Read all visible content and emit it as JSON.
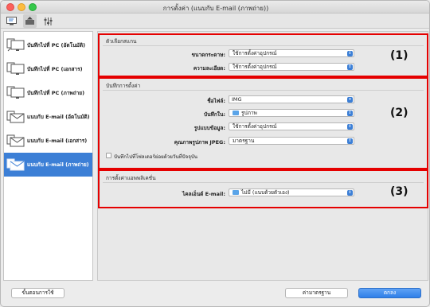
{
  "window": {
    "title": "การตั้งค่า (แนบกับ E-mail (ภาพถ่าย))"
  },
  "toolbar": {
    "tabs": [
      {
        "icon": "scan-from-computer-icon"
      },
      {
        "icon": "scan-from-operation-panel-icon"
      },
      {
        "icon": "general-settings-icon"
      }
    ]
  },
  "sidebar": {
    "items": [
      {
        "label": "บันทึกไปที่ PC (อัตโนมัติ)",
        "icon": "save-to-pc-icon"
      },
      {
        "label": "บันทึกไปที่ PC (เอกสาร)",
        "icon": "save-to-pc-icon"
      },
      {
        "label": "บันทึกไปที่ PC (ภาพถ่าย)",
        "icon": "save-to-pc-icon"
      },
      {
        "label": "แนบกับ E-mail (อัตโนมัติ)",
        "icon": "email-icon"
      },
      {
        "label": "แนบกับ E-mail (เอกสาร)",
        "icon": "email-icon"
      },
      {
        "label": "แนบกับ E-mail (ภาพถ่าย)",
        "icon": "email-icon"
      }
    ],
    "selected_index": 5
  },
  "scan_options": {
    "title": "ตัวเลือกสแกน",
    "paper_size_label": "ขนาดกระดาษ:",
    "paper_size_value": "ใช้การตั้งค่าอุปกรณ์",
    "resolution_label": "ความละเอียด:",
    "resolution_value": "ใช้การตั้งค่าอุปกรณ์"
  },
  "save_settings": {
    "title": "บันทึกการตั้งค่า",
    "file_name_label": "ชื่อไฟล์:",
    "file_name_value": "IMG",
    "save_in_label": "บันทึกใน:",
    "save_in_value": "รูปภาพ",
    "data_format_label": "รูปแบบข้อมูล:",
    "data_format_value": "ใช้การตั้งค่าอุปกรณ์",
    "jpeg_quality_label": "คุณภาพรูปภาพ JPEG:",
    "jpeg_quality_value": "มาตรฐาน",
    "subfolder_checkbox_label": "บันทึกไปที่โฟลเดอร์ย่อยด้วยวันที่ปัจจุบัน",
    "subfolder_checked": false
  },
  "app_settings": {
    "title": "การตั้งค่าแอพพลิเคชั่น",
    "email_client_label": "ไคลเอ็นต์ E-mail:",
    "email_client_value": "ไม่มี (แนบด้วยตัวเอง)"
  },
  "callouts": {
    "c1": "(1)",
    "c2": "(2)",
    "c3": "(3)"
  },
  "buttons": {
    "instructions": "ขั้นตอนการใช้",
    "defaults": "ค่ามาตรฐาน",
    "ok": "ตกลง"
  },
  "colors": {
    "accent": "#3c7fd6",
    "highlight_border": "#e50000",
    "selected_row": "#3c7fd6"
  }
}
